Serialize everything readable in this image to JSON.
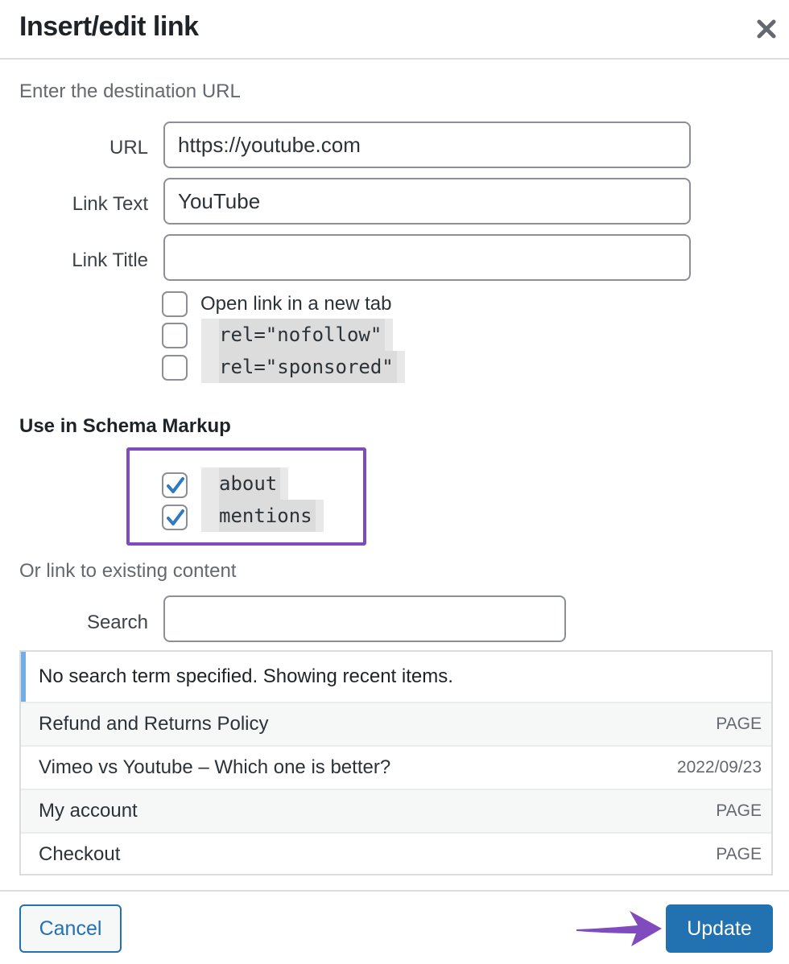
{
  "dialog": {
    "title": "Insert/edit link",
    "close_icon": "close-icon",
    "close_glyph": "✕"
  },
  "url_section": {
    "heading": "Enter the destination URL",
    "fields": {
      "url": {
        "label": "URL",
        "value": "https://youtube.com",
        "placeholder": ""
      },
      "link_text": {
        "label": "Link Text",
        "value": "YouTube",
        "placeholder": ""
      },
      "link_title": {
        "label": "Link Title",
        "value": "",
        "placeholder": ""
      }
    },
    "options": [
      {
        "label": "Open link in a new tab",
        "checked": false,
        "code": false
      },
      {
        "label": "rel=\"nofollow\"",
        "checked": false,
        "code": true
      },
      {
        "label": "rel=\"sponsored\"",
        "checked": false,
        "code": true
      }
    ]
  },
  "schema_section": {
    "heading": "Use in Schema Markup",
    "highlight_color": "#7f4bbd",
    "options": [
      {
        "label": "about",
        "checked": true
      },
      {
        "label": "mentions",
        "checked": true
      }
    ]
  },
  "existing_content": {
    "heading": "Or link to existing content",
    "search": {
      "label": "Search",
      "value": "",
      "placeholder": ""
    },
    "notice": "No search term specified. Showing recent items.",
    "results": [
      {
        "title": "Refund and Returns Policy",
        "info": "PAGE"
      },
      {
        "title": "Vimeo vs Youtube – Which one is better?",
        "info": "2022/09/23"
      },
      {
        "title": "My account",
        "info": "PAGE"
      },
      {
        "title": "Checkout",
        "info": "PAGE"
      }
    ]
  },
  "footer": {
    "cancel_label": "Cancel",
    "update_label": "Update",
    "accent_color": "#2271b1",
    "annotation_arrow_color": "#7f4bbd"
  }
}
